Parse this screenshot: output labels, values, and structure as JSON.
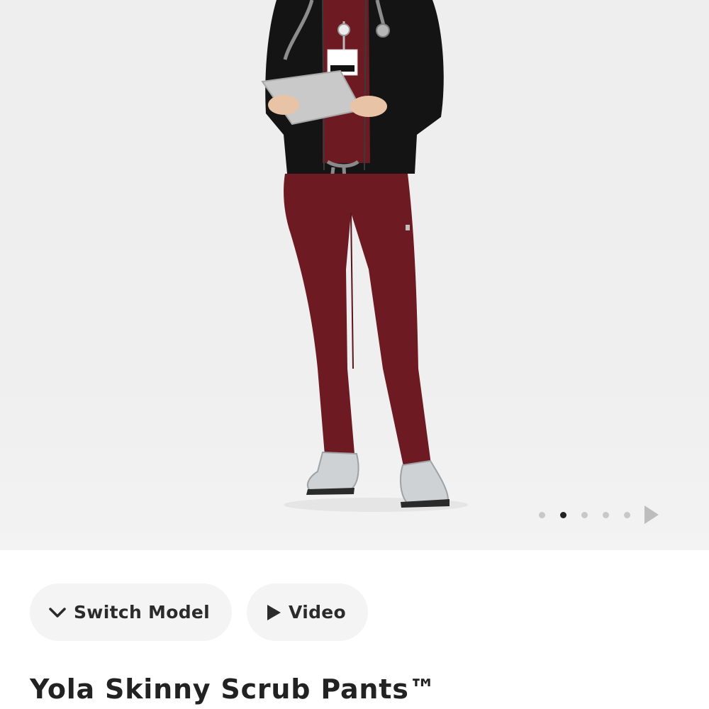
{
  "gallery": {
    "image_alt": "Yola Skinny Scrub Pants",
    "dot_count": 5,
    "active_index": 1,
    "next_icon": "play-triangle-icon"
  },
  "actions": {
    "switch_model_label": "Switch Model",
    "switch_model_icon": "chevron-down-icon",
    "video_label": "Video",
    "video_icon": "play-icon"
  },
  "product": {
    "title": "Yola Skinny Scrub Pants™"
  },
  "colors": {
    "pants": "#6e1a22",
    "jacket": "#141414",
    "pill_bg": "#f4f4f4",
    "text": "#222222",
    "dot_active": "#222222",
    "dot_inactive": "#c8c8c8"
  }
}
